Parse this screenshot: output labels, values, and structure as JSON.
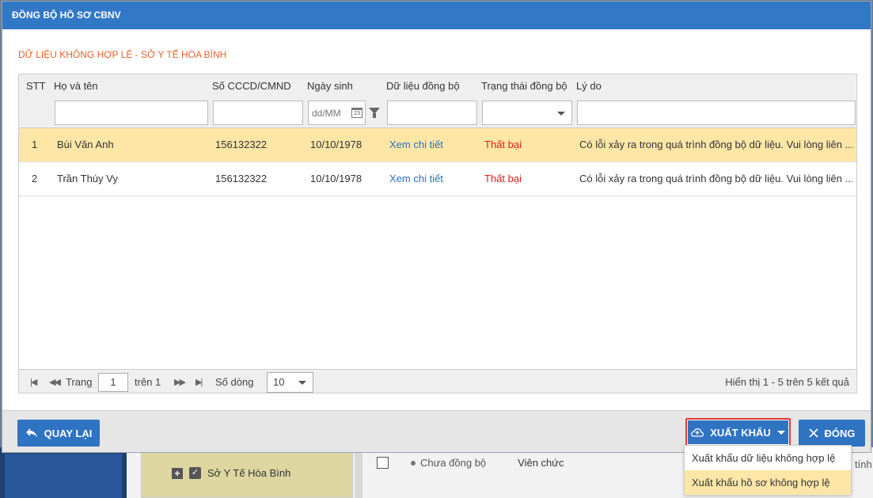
{
  "dialog": {
    "title": "ĐỒNG BỘ HỒ SƠ CBNV",
    "section_title": "DỮ LIỆU KHÔNG HỢP LỆ - SỞ Y TẾ HÒA BÌNH"
  },
  "grid": {
    "columns": [
      "STT",
      "Họ và tên",
      "Số CCCD/CMND",
      "Ngày sinh",
      "Dữ liệu đồng bộ",
      "Trạng thái đồng bộ",
      "Lý do"
    ],
    "date_placeholder": "dd/MM",
    "rows": [
      {
        "stt": "1",
        "name": "Bùi Văn Anh",
        "id": "156132322",
        "dob": "10/10/1978",
        "data": "Xem chi tiết",
        "status": "Thất bại",
        "reason": "Có lỗi xảy ra trong quá trình đồng bộ dữ liệu. Vui lòng liên ..."
      },
      {
        "stt": "2",
        "name": "Trần Thúy Vy",
        "id": "156132322",
        "dob": "10/10/1978",
        "data": "Xem chi tiết",
        "status": "Thất bại",
        "reason": "Có lỗi xảy ra trong quá trình đồng bộ dữ liệu. Vui lòng liên ..."
      }
    ],
    "pager": {
      "page_label": "Trang",
      "page": "1",
      "of_label": "trên 1",
      "rows_label": "Số dòng",
      "rows_value": "10",
      "summary": "Hiển thị 1 - 5 trên 5 kết quả"
    }
  },
  "footer": {
    "back_label": "QUAY LẠI",
    "export_label": "XUẤT KHẨU",
    "close_label": "ĐÓNG"
  },
  "export_menu": [
    "Xuất khẩu dữ liệu không hợp lệ",
    "Xuất khẩu hồ sơ không hợp lệ"
  ],
  "background": {
    "tree_item": "Sở Y Tế Hòa Bình",
    "status": "Chưa đồng bộ",
    "type": "Viên chức",
    "right_text": "tính"
  },
  "colors": {
    "header": "#3178c6",
    "button": "#2f73c3",
    "selected_row": "#fde6a6",
    "fail": "#e02020",
    "link": "#2f6fc0",
    "title": "#e8612c"
  }
}
